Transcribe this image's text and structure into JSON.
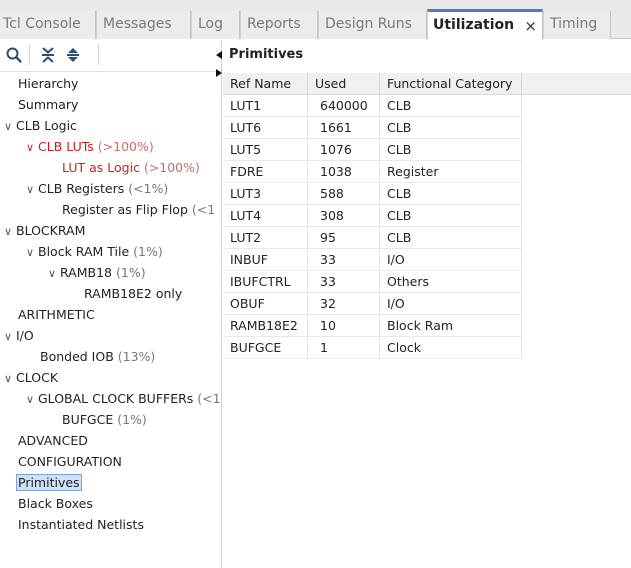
{
  "tabs": [
    {
      "label": "Tcl Console",
      "active": false
    },
    {
      "label": "Messages",
      "active": false
    },
    {
      "label": "Log",
      "active": false
    },
    {
      "label": "Reports",
      "active": false
    },
    {
      "label": "Design Runs",
      "active": false
    },
    {
      "label": "Utilization",
      "active": true,
      "close": "×"
    },
    {
      "label": "Timing",
      "active": false
    }
  ],
  "toolbar": {
    "search_icon": "search-icon",
    "collapse_all_icon": "collapse-all-icon",
    "expand_all_icon": "expand-all-icon"
  },
  "tree": [
    {
      "label": "Hierarchy",
      "pct": "",
      "expanded": null
    },
    {
      "label": "Summary",
      "pct": "",
      "expanded": null
    },
    {
      "label": "CLB Logic",
      "pct": "",
      "expanded": true
    },
    {
      "label": "CLB LUTs",
      "pct": "(>100%)",
      "expanded": true,
      "status": "over"
    },
    {
      "label": "LUT as Logic",
      "pct": "(>100%)",
      "expanded": null,
      "status": "over"
    },
    {
      "label": "CLB Registers",
      "pct": "(<1%)",
      "expanded": true
    },
    {
      "label": "Register as Flip Flop",
      "pct": "(<1",
      "expanded": null
    },
    {
      "label": "BLOCKRAM",
      "pct": "",
      "expanded": true
    },
    {
      "label": "Block RAM Tile",
      "pct": "(1%)",
      "expanded": true
    },
    {
      "label": "RAMB18",
      "pct": "(1%)",
      "expanded": true
    },
    {
      "label": "RAMB18E2 only",
      "pct": "",
      "expanded": null
    },
    {
      "label": "ARITHMETIC",
      "pct": "",
      "expanded": null
    },
    {
      "label": "I/O",
      "pct": "",
      "expanded": true
    },
    {
      "label": "Bonded IOB",
      "pct": "(13%)",
      "expanded": null
    },
    {
      "label": "CLOCK",
      "pct": "",
      "expanded": true
    },
    {
      "label": "GLOBAL CLOCK BUFFERs",
      "pct": "(<1",
      "expanded": true
    },
    {
      "label": "BUFGCE",
      "pct": "(1%)",
      "expanded": null
    },
    {
      "label": "ADVANCED",
      "pct": "",
      "expanded": null
    },
    {
      "label": "CONFIGURATION",
      "pct": "",
      "expanded": null
    },
    {
      "label": "Primitives",
      "pct": "",
      "expanded": null,
      "selected": true
    },
    {
      "label": "Black Boxes",
      "pct": "",
      "expanded": null
    },
    {
      "label": "Instantiated Netlists",
      "pct": "",
      "expanded": null
    }
  ],
  "panel": {
    "title": "Primitives",
    "columns": [
      "Ref Name",
      "Used",
      "Functional Category"
    ],
    "rows": [
      [
        "LUT1",
        "640000",
        "CLB"
      ],
      [
        "LUT6",
        "1661",
        "CLB"
      ],
      [
        "LUT5",
        "1076",
        "CLB"
      ],
      [
        "FDRE",
        "1038",
        "Register"
      ],
      [
        "LUT3",
        "588",
        "CLB"
      ],
      [
        "LUT4",
        "308",
        "CLB"
      ],
      [
        "LUT2",
        "95",
        "CLB"
      ],
      [
        "INBUF",
        "33",
        "I/O"
      ],
      [
        "IBUFCTRL",
        "33",
        "Others"
      ],
      [
        "OBUF",
        "32",
        "I/O"
      ],
      [
        "RAMB18E2",
        "10",
        "Block Ram"
      ],
      [
        "BUFGCE",
        "1",
        "Clock"
      ]
    ]
  },
  "colors": {
    "accent": "#4d7cc9",
    "over_utilized": "#cc1f1f",
    "selection": "#cfe0f7"
  }
}
